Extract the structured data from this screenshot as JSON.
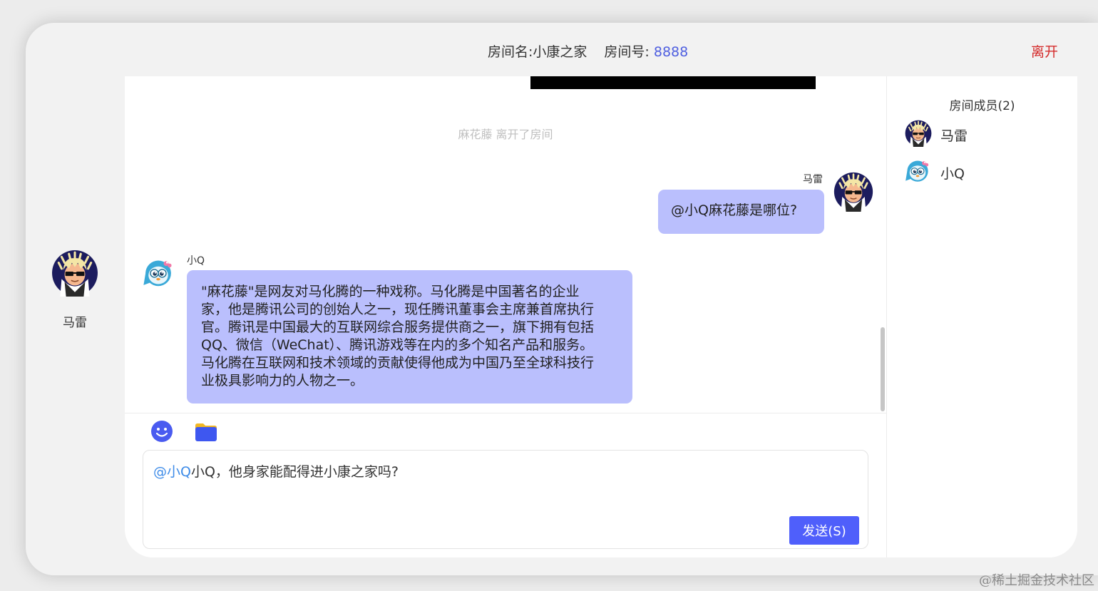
{
  "header": {
    "room_name_label": "房间名:",
    "room_name": "小康之家",
    "room_id_label": "房间号:",
    "room_id": "8888",
    "leave_label": "离开"
  },
  "current_user": {
    "name": "马雷",
    "avatar": "sunglasses-guy-avatar"
  },
  "chat": {
    "system_message": "麻花藤 离开了房间",
    "messages": [
      {
        "sender": "马雷",
        "side": "right",
        "avatar": "sunglasses-guy-avatar",
        "text": "@小Q麻花藤是哪位?"
      },
      {
        "sender": "小Q",
        "side": "left",
        "avatar": "robot-penguin-avatar",
        "lines": [
          "\"麻花藤\"是网友对马化腾的一种戏称。马化腾是中国著名的企业",
          "家，他是腾讯公司的创始人之一，现任腾讯董事会主席兼首席执行",
          "官。腾讯是中国最大的互联网综合服务提供商之一，旗下拥有包括",
          "QQ、微信（WeChat）、腾讯游戏等在内的多个知名产品和服务。",
          "马化腾在互联网和技术领域的贡献使得他成为中国乃至全球科技行",
          "业极具影响力的人物之一。"
        ]
      }
    ]
  },
  "composer": {
    "mention": "@小Q",
    "text": "小Q，他身家能配得进小康之家吗?",
    "send_label": "发送(S)",
    "tools": [
      "emoji-icon",
      "folder-icon"
    ]
  },
  "members": {
    "title": "房间成员(2)",
    "list": [
      {
        "name": "马雷",
        "avatar": "sunglasses-guy-avatar"
      },
      {
        "name": "小Q",
        "avatar": "robot-penguin-avatar"
      }
    ]
  },
  "colors": {
    "bubble": "#babffd",
    "accent": "#4f5ffb",
    "room_id": "#4f5fe0",
    "leave": "#d42a2a",
    "mention": "#3d8be8"
  },
  "watermark": "@稀土掘金技术社区"
}
